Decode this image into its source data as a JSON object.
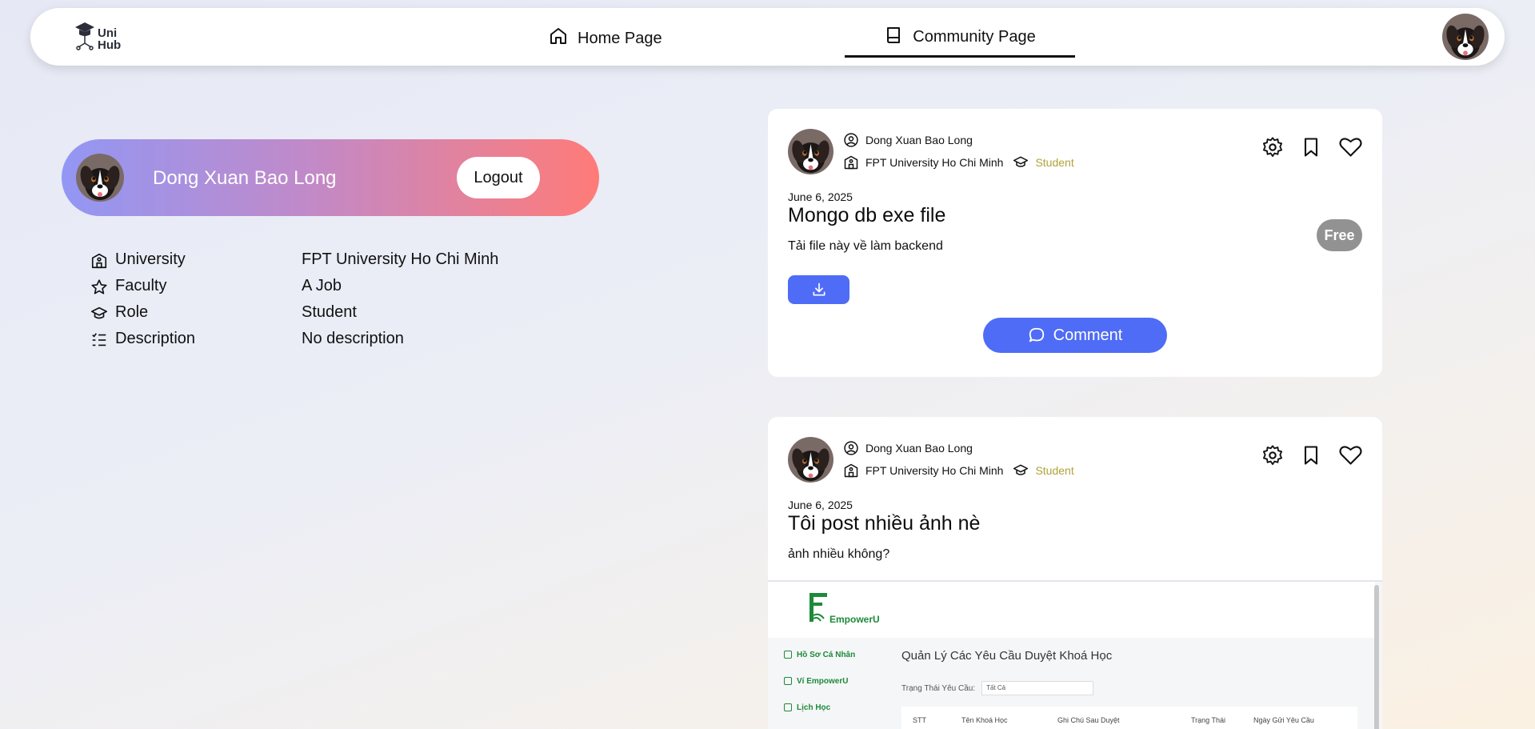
{
  "nav": {
    "logo_text_1": "Uni",
    "logo_text_2": "Hub",
    "home_label": "Home Page",
    "community_label": "Community Page"
  },
  "profile": {
    "name": "Dong Xuan Bao Long",
    "logout_label": "Logout",
    "rows": [
      {
        "label": "University",
        "value": "FPT University Ho Chi Minh",
        "icon": "building-icon"
      },
      {
        "label": "Faculty",
        "value": "A Job",
        "icon": "star-icon"
      },
      {
        "label": "Role",
        "value": "Student",
        "icon": "graduation-cap-icon"
      },
      {
        "label": "Description",
        "value": "No description",
        "icon": "list-icon"
      }
    ]
  },
  "posts": [
    {
      "author": "Dong Xuan Bao Long",
      "university": "FPT University Ho Chi Minh",
      "role": "Student",
      "date": "June 6, 2025",
      "title": "Mongo db exe file",
      "description": "Tải file này về làm backend",
      "badge": "Free",
      "comment_label": "Comment"
    },
    {
      "author": "Dong Xuan Bao Long",
      "university": "FPT University Ho Chi Minh",
      "role": "Student",
      "date": "June 6, 2025",
      "title": "Tôi post nhiều ảnh nè",
      "description": "ảnh nhiều không?"
    }
  ],
  "embed": {
    "brand": "EmpowerU",
    "sidebar": [
      "Hồ Sơ Cá Nhân",
      "Ví EmpowerU",
      "Lịch Học"
    ],
    "title": "Quản Lý Các Yêu Cầu Duyệt Khoá Học",
    "filter_label": "Trạng Thái Yêu Cầu:",
    "filter_value": "Tất Cả",
    "columns": [
      "STT",
      "Tên Khoá Học",
      "Ghi Chú Sau Duyệt",
      "Trạng Thái",
      "Ngày Gửi Yêu Cầu"
    ]
  },
  "colors": {
    "accent": "#4f6cf6",
    "role_tag": "#b0a23a",
    "badge_bg": "#929292"
  }
}
